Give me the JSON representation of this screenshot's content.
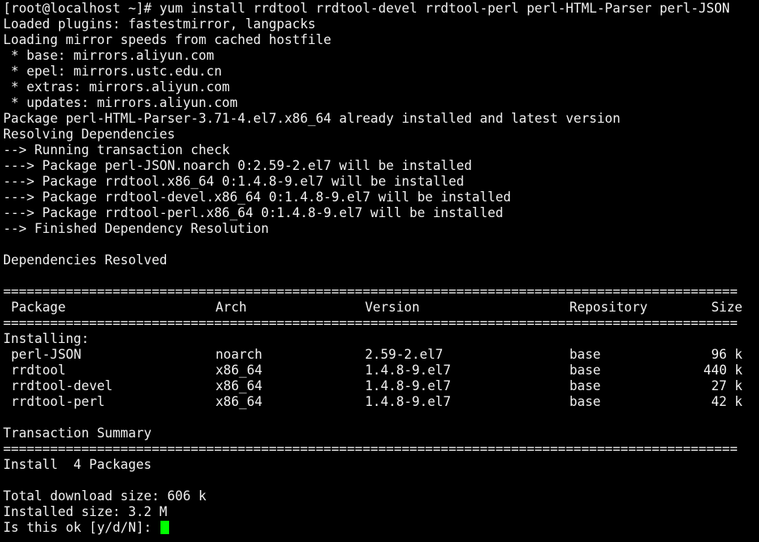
{
  "colors": {
    "background": "#000000",
    "foreground": "#f0f0f0",
    "cursor": "#00ff00"
  },
  "command": {
    "prompt": "[root@localhost ~]# ",
    "text": "yum install rrdtool rrdtool-devel rrdtool-perl perl-HTML-Parser perl-JSON"
  },
  "output_lines": [
    "Loaded plugins: fastestmirror, langpacks",
    "Loading mirror speeds from cached hostfile",
    " * base: mirrors.aliyun.com",
    " * epel: mirrors.ustc.edu.cn",
    " * extras: mirrors.aliyun.com",
    " * updates: mirrors.aliyun.com",
    "Package perl-HTML-Parser-3.71-4.el7.x86_64 already installed and latest version",
    "Resolving Dependencies",
    "--> Running transaction check",
    "---> Package perl-JSON.noarch 0:2.59-2.el7 will be installed",
    "---> Package rrdtool.x86_64 0:1.4.8-9.el7 will be installed",
    "---> Package rrdtool-devel.x86_64 0:1.4.8-9.el7 will be installed",
    "---> Package rrdtool-perl.x86_64 0:1.4.8-9.el7 will be installed",
    "--> Finished Dependency Resolution",
    "",
    "Dependencies Resolved",
    ""
  ],
  "separator": "==============================================================================================",
  "table": {
    "headers": {
      "package": "Package",
      "arch": "Arch",
      "version": "Version",
      "repository": "Repository",
      "size": "Size"
    },
    "section_label": "Installing:",
    "rows": [
      {
        "package": "perl-JSON",
        "arch": "noarch",
        "version": "2.59-2.el7",
        "repository": "base",
        "size": "96 k"
      },
      {
        "package": "rrdtool",
        "arch": "x86_64",
        "version": "1.4.8-9.el7",
        "repository": "base",
        "size": "440 k"
      },
      {
        "package": "rrdtool-devel",
        "arch": "x86_64",
        "version": "1.4.8-9.el7",
        "repository": "base",
        "size": "27 k"
      },
      {
        "package": "rrdtool-perl",
        "arch": "x86_64",
        "version": "1.4.8-9.el7",
        "repository": "base",
        "size": "42 k"
      }
    ]
  },
  "summary": {
    "title": "Transaction Summary",
    "install_line": "Install  4 Packages",
    "download_size": "Total download size: 606 k",
    "installed_size": "Installed size: 3.2 M",
    "prompt": "Is this ok [y/d/N]: "
  }
}
